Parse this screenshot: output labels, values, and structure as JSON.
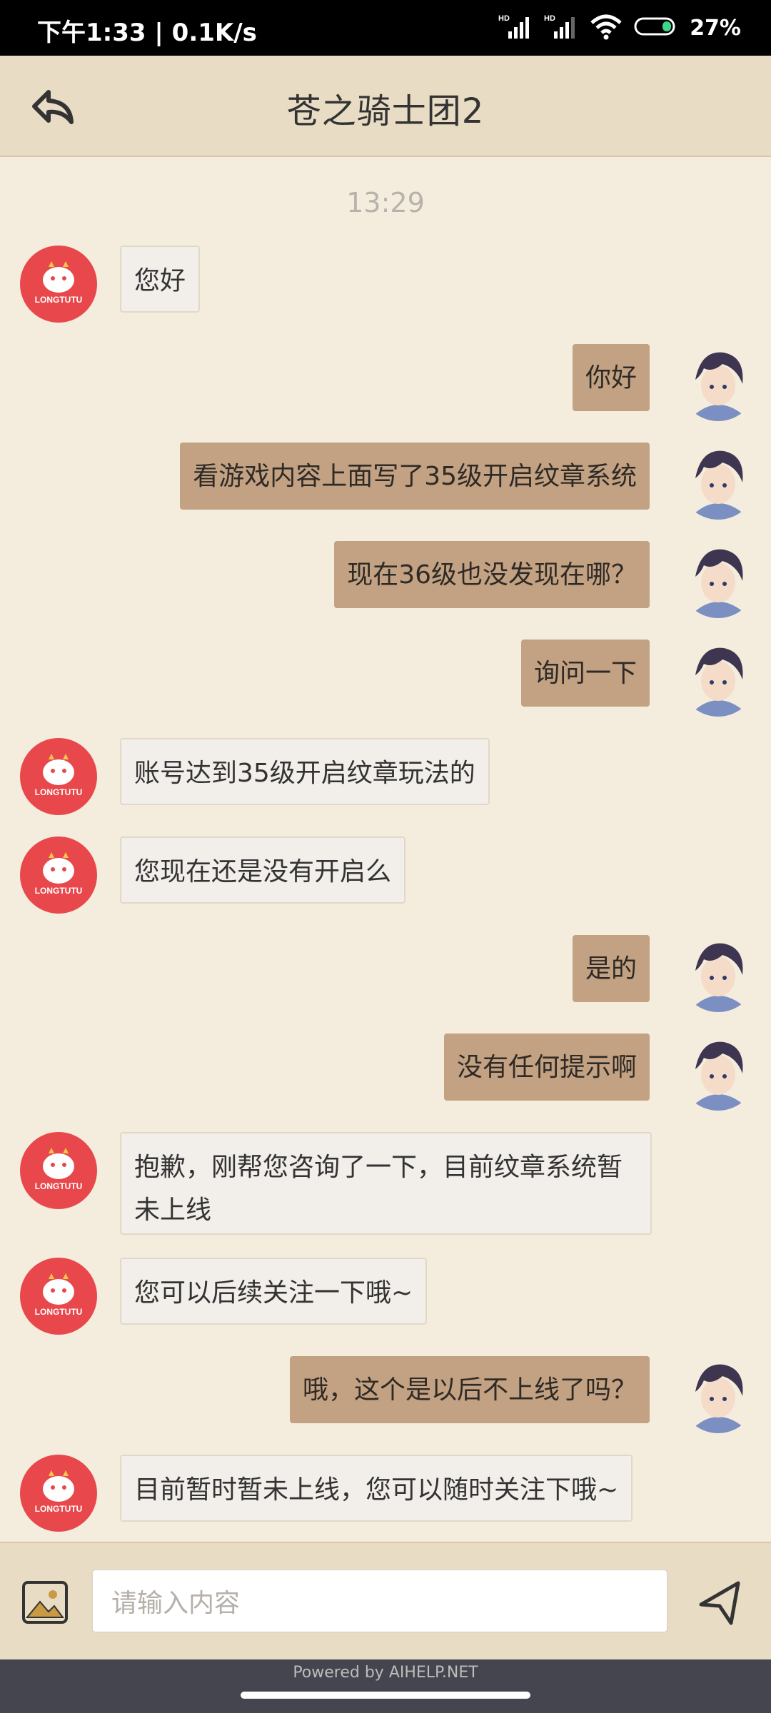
{
  "status_bar": {
    "time_speed": "下午1:33 | 0.1K/s",
    "net1": "HD",
    "net2": "HD",
    "battery": "27%"
  },
  "header": {
    "title": "苍之骑士团2"
  },
  "chat": {
    "time": "13:29",
    "bot_logo_text": "LONGTUTU",
    "messages": [
      {
        "from": "bot",
        "text": "您好"
      },
      {
        "from": "user",
        "text": "你好"
      },
      {
        "from": "user",
        "text": "看游戏内容上面写了35级开启纹章系统"
      },
      {
        "from": "user",
        "text": "现在36级也没发现在哪？"
      },
      {
        "from": "user",
        "text": "询问一下"
      },
      {
        "from": "bot",
        "text": "账号达到35级开启纹章玩法的"
      },
      {
        "from": "bot",
        "text": "您现在还是没有开启么"
      },
      {
        "from": "user",
        "text": "是的"
      },
      {
        "from": "user",
        "text": "没有任何提示啊"
      },
      {
        "from": "bot",
        "text": "抱歉，刚帮您咨询了一下，目前纹章系统暂未上线"
      },
      {
        "from": "bot",
        "text": "您可以后续关注一下哦~"
      },
      {
        "from": "user",
        "text": "哦，这个是以后不上线了吗？"
      },
      {
        "from": "bot",
        "text": "目前暂时暂未上线，您可以随时关注下哦~"
      }
    ]
  },
  "input": {
    "placeholder": "请输入内容"
  },
  "footer": {
    "powered_by": "Powered by AIHELP.NET"
  },
  "colors": {
    "header_bg": "#e8dcc4",
    "chat_bg": "#f4ecdd",
    "user_bubble": "#c3a283",
    "bot_bubble": "#f2eeea",
    "bot_avatar": "#e8474b"
  },
  "icons": {
    "back": "reply-arrow-icon",
    "image": "image-icon",
    "send": "send-icon",
    "wifi": "wifi-icon",
    "signal": "signal-icon",
    "battery": "battery-icon"
  }
}
